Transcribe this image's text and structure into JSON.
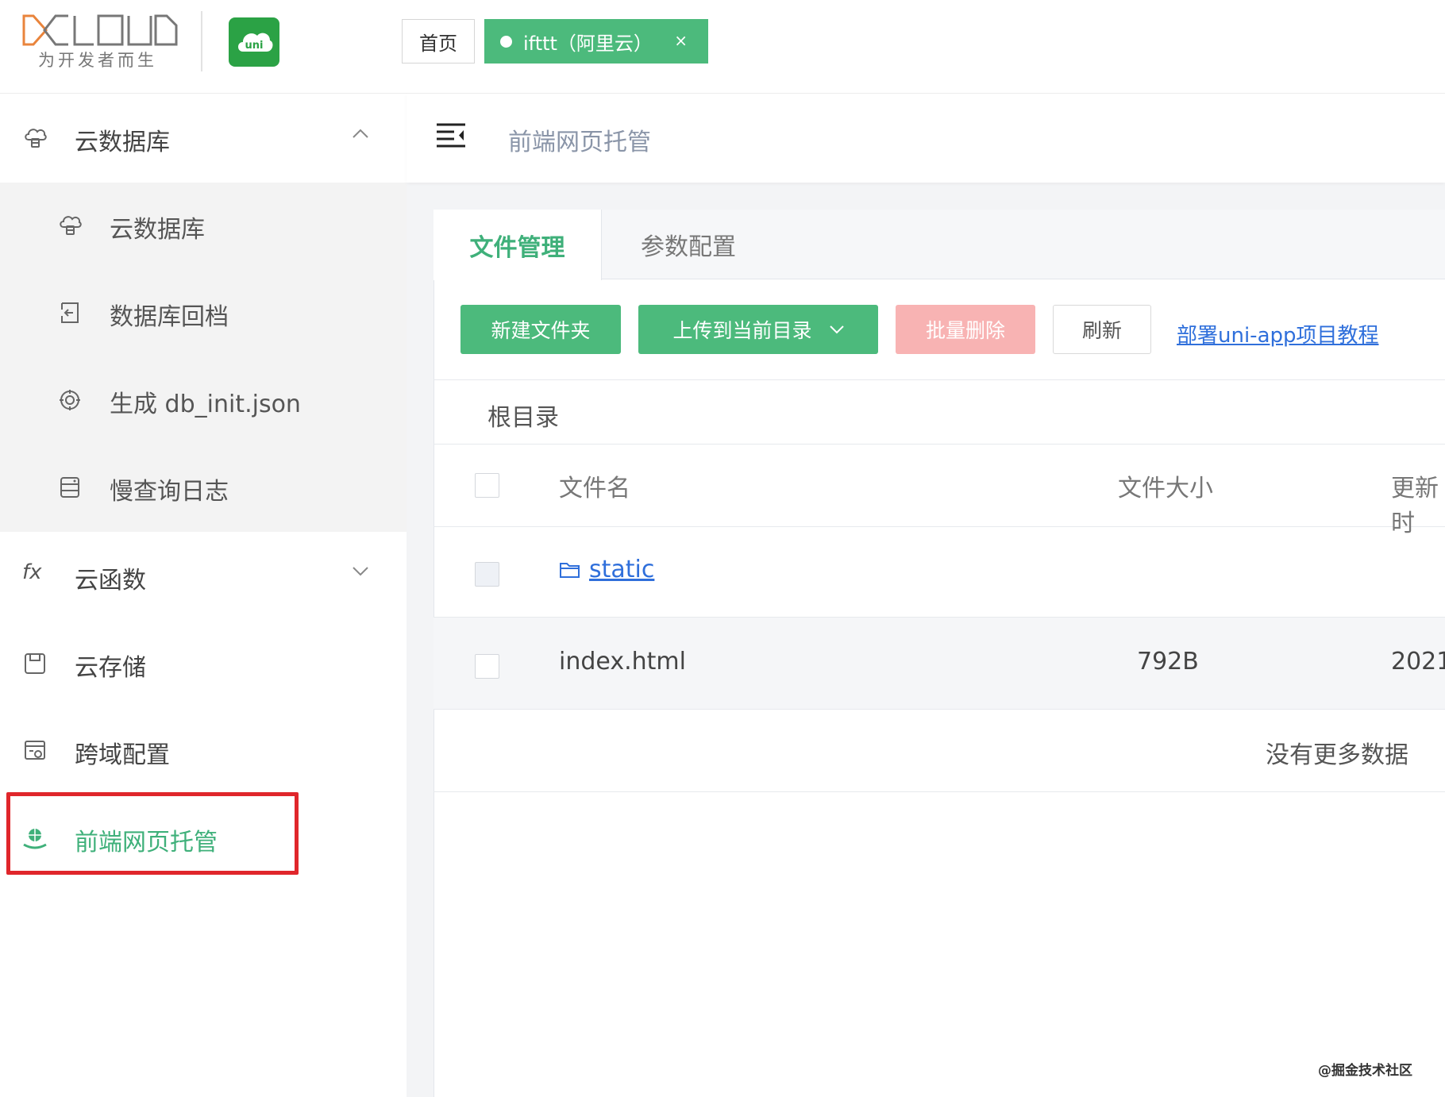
{
  "brand": {
    "logo_text": "DCLOUD",
    "slogan": "为开发者而生",
    "uni_logo_text": "uni"
  },
  "tabs": {
    "home": "首页",
    "active": "ifttt（阿里云）",
    "close": "×"
  },
  "sidebar": {
    "group_database": "云数据库",
    "sub_items": [
      {
        "label": "云数据库",
        "icon": "cloud-database-icon"
      },
      {
        "label": "数据库回档",
        "icon": "rollback-icon"
      },
      {
        "label": "生成 db_init.json",
        "icon": "generate-icon"
      },
      {
        "label": "慢查询日志",
        "icon": "log-icon"
      }
    ],
    "functions": "云函数",
    "functions_icon_text": "fx",
    "storage": "云存储",
    "cors": "跨域配置",
    "hosting": "前端网页托管"
  },
  "breadcrumb": "前端网页托管",
  "card_tabs": {
    "file_manage": "文件管理",
    "params": "参数配置"
  },
  "toolbar": {
    "new_folder": "新建文件夹",
    "upload": "上传到当前目录",
    "batch_delete": "批量删除",
    "refresh": "刷新",
    "tutorial": "部署uni-app项目教程"
  },
  "root_dir": "根目录",
  "table": {
    "headers": {
      "name": "文件名",
      "size": "文件大小",
      "updated": "更新时"
    },
    "rows": [
      {
        "name": "static",
        "size": "",
        "updated": ""
      },
      {
        "name": "index.html",
        "size": "792B",
        "updated": "2021"
      }
    ],
    "empty": "没有更多数据"
  },
  "watermark": "@掘金技术社区",
  "colors": {
    "accent": "#4cba7c",
    "danger_disabled": "#f8b3b3",
    "link": "#2f6fdb",
    "highlight": "#e0262b"
  }
}
